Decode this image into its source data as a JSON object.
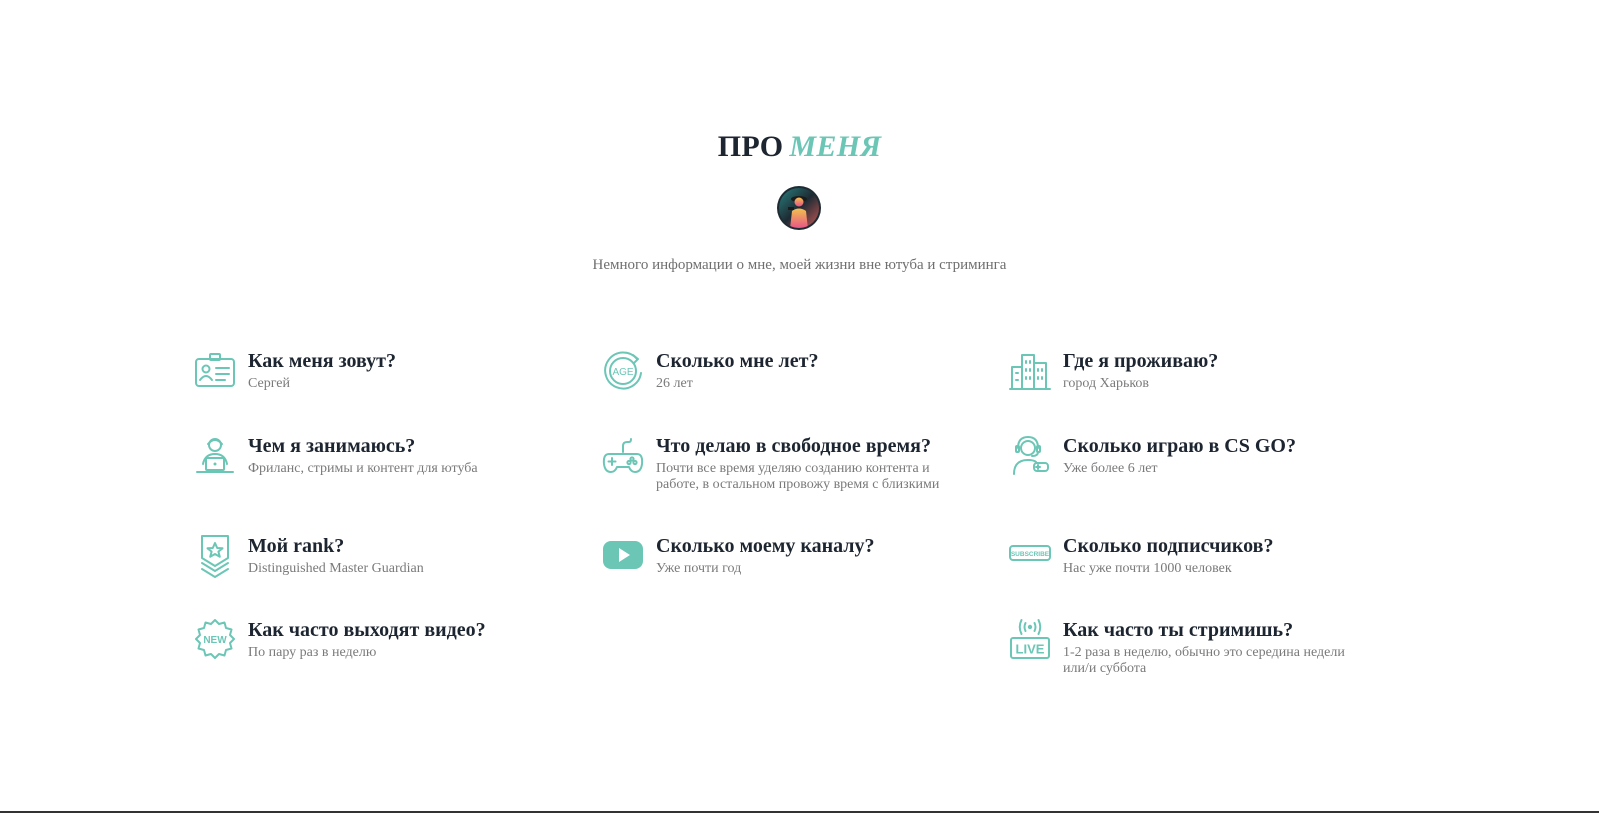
{
  "section": {
    "title_main": "ПРО",
    "title_accent": "МЕНЯ",
    "subtitle": "Немного информации о мне, моей жизни вне ютуба и стриминга"
  },
  "colors": {
    "accent": "#6cc6b6",
    "heading": "#1d2530",
    "muted": "#7a7a7a"
  },
  "items": [
    {
      "icon": "id-card-icon",
      "title": "Как меня зовут?",
      "text": "Сергей"
    },
    {
      "icon": "age-icon",
      "title": "Сколько мне лет?",
      "text": "26 лет"
    },
    {
      "icon": "city-icon",
      "title": "Где я проживаю?",
      "text": "город Харьков"
    },
    {
      "icon": "freelancer-icon",
      "title": "Чем я занимаюсь?",
      "text": "Фриланс, стримы и контент для ютуба"
    },
    {
      "icon": "gamepad-icon",
      "title": "Что делаю в свободное время?",
      "text": "Почти все время уделяю созданию контента и работе, в остальном провожу время с близкими"
    },
    {
      "icon": "gamer-headset-icon",
      "title": "Сколько играю в CS GO?",
      "text": "Уже более 6 лет"
    },
    {
      "icon": "rank-badge-icon",
      "title": "Мой rank?",
      "text": "Distinguished Master Guardian"
    },
    {
      "icon": "youtube-icon",
      "title": "Сколько моему каналу?",
      "text": "Уже почти год"
    },
    {
      "icon": "subscribe-icon",
      "title": "Сколько подписчиков?",
      "text": "Нас уже почти 1000 человек"
    },
    {
      "icon": "new-badge-icon",
      "title": "Как часто выходят видео?",
      "text": "По пару раз в неделю"
    },
    {
      "icon": "live-icon",
      "title": "Как часто ты стримишь?",
      "text": "1-2 раза в неделю, обычно это середина недели или/и суббота"
    }
  ],
  "icon_labels": {
    "age": "AGE",
    "new": "NEW",
    "live": "LIVE",
    "subscribe": "SUBSCRIBE"
  }
}
